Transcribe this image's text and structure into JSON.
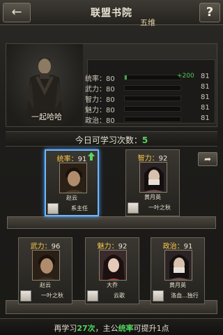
{
  "header": {
    "back_icon": "back-arrow-icon",
    "title": "联盟书院",
    "help_label": "?"
  },
  "hero": {
    "name": "一起哈哈",
    "attributes_title": "五维",
    "attributes": [
      {
        "label": "统率：80",
        "current": 80,
        "bonus": "+200",
        "max": "81"
      },
      {
        "label": "武力：80",
        "current": 80,
        "bonus": "",
        "max": "81"
      },
      {
        "label": "智力：80",
        "current": 80,
        "bonus": "",
        "max": "81"
      },
      {
        "label": "魅力：80",
        "current": 80,
        "bonus": "",
        "max": "81"
      },
      {
        "label": "政治：80",
        "current": 80,
        "bonus": "",
        "max": "81"
      }
    ]
  },
  "study": {
    "label": "今日可学习次数：",
    "count": "5"
  },
  "share_icon": "share-icon",
  "cards": [
    {
      "stat_label": "统率：",
      "stat_value": "91",
      "hero": "赵云",
      "player": "系主任",
      "selected": true,
      "upgrade": true
    },
    {
      "stat_label": "智力：",
      "stat_value": "92",
      "hero": "黄月英",
      "player": "一叶之秋",
      "selected": false,
      "upgrade": false
    },
    {
      "stat_label": "武力：",
      "stat_value": "96",
      "hero": "赵云",
      "player": "一叶之秋",
      "selected": false,
      "upgrade": false
    },
    {
      "stat_label": "魅力：",
      "stat_value": "92",
      "hero": "大乔",
      "player": "云歌",
      "selected": false,
      "upgrade": false
    },
    {
      "stat_label": "政治：",
      "stat_value": "91",
      "hero": "黄月英",
      "player": "洛血...独行",
      "selected": false,
      "upgrade": false
    }
  ],
  "footer": {
    "prefix": "再学习",
    "times": "27次",
    "middle": "，主公",
    "attr": "统率",
    "suffix": "可提升1点"
  },
  "colors": {
    "accent_green": "#52d55d",
    "stat_gold": "#ffc94a",
    "select_blue": "#6fb8ff"
  }
}
